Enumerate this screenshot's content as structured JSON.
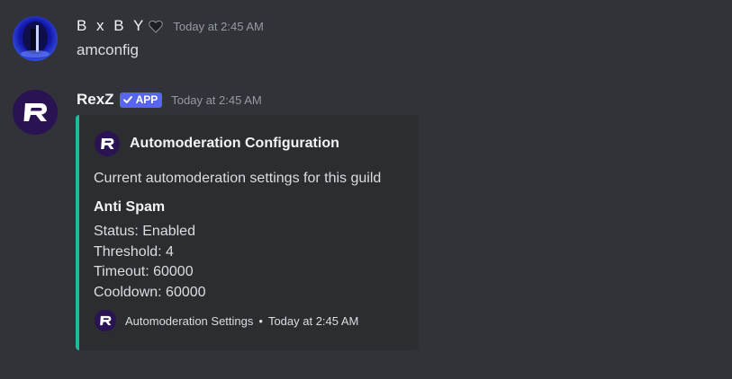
{
  "messages": [
    {
      "username": "B x B Y",
      "timestamp": "Today at 2:45 AM",
      "content": "amconfig"
    },
    {
      "username": "RexZ",
      "badge": "APP",
      "timestamp": "Today at 2:45 AM",
      "embed": {
        "title": "Automoderation Configuration",
        "description": "Current automoderation settings for this guild",
        "field_name": "Anti Spam",
        "field_lines": [
          "Status: Enabled",
          "Threshold: 4",
          "Timeout: 60000",
          "Cooldown: 60000"
        ],
        "footer_text": "Automoderation Settings",
        "footer_separator": "•",
        "footer_timestamp": "Today at 2:45 AM",
        "accent_color": "#1abc9c"
      }
    }
  ],
  "colors": {
    "background": "#313338",
    "embed_background": "#2b2d31",
    "badge": "#5865f2",
    "timestamp": "#949ba4"
  },
  "icons": {
    "heart": "black-heart-icon",
    "check": "check-icon",
    "bot_logo": "rexz-logo-icon"
  }
}
